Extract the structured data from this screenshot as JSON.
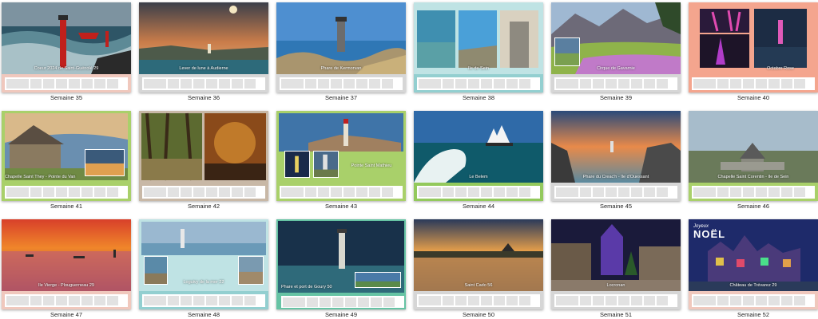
{
  "weeks": [
    {
      "label": "Semaine 35",
      "caption": "Coeur 2024 de Saint-Guénolé 29",
      "frame": "#f0c8bd"
    },
    {
      "label": "Semaine 36",
      "caption": "Lever de lune à Audierne",
      "frame": "#d6d6d6"
    },
    {
      "label": "Semaine 37",
      "caption": "Phare de Kermorvan",
      "frame": "#d6d6d6"
    },
    {
      "label": "Semaine 38",
      "caption": "Ile de Sein",
      "frame": "#93cfd0"
    },
    {
      "label": "Semaine 39",
      "caption": "Cirque de Gavarnie",
      "frame": "#d6d6d6"
    },
    {
      "label": "Semaine 40",
      "caption": "Octobre Rose",
      "frame": "#f4a58e"
    },
    {
      "label": "Semaine 41",
      "caption": "Chapelle Saint They - Pointe du Van",
      "frame": "#a9d06a"
    },
    {
      "label": "Semaine 42",
      "caption": "",
      "frame": "#c8b8a6"
    },
    {
      "label": "Semaine 43",
      "caption": "Pointe Saint Mathieu",
      "frame": "#a9d06a"
    },
    {
      "label": "Semaine 44",
      "caption": "Le Belem",
      "frame": "#93c95c"
    },
    {
      "label": "Semaine 45",
      "caption": "Phare du Creac'h - île d'Ouessant",
      "frame": "#d6d6d6"
    },
    {
      "label": "Semaine 46",
      "caption": "Chapelle Saint Corentin - Ile de Sein",
      "frame": "#a9d06a"
    },
    {
      "label": "Semaine 47",
      "caption": "Ile Vierge - Plouguerneau 29",
      "frame": "#f0c8bd"
    },
    {
      "label": "Semaine 48",
      "caption": "Loguivy de la mer 22",
      "frame": "#93cfd0"
    },
    {
      "label": "Semaine 49",
      "caption": "Phare et port de Goury 50",
      "frame": "#66c3a4"
    },
    {
      "label": "Semaine 50",
      "caption": "Saint Cado 56",
      "frame": "#d6d6d6"
    },
    {
      "label": "Semaine 51",
      "caption": "Locronan",
      "frame": "#d6d6d6"
    },
    {
      "label": "Semaine 52",
      "caption": "Château de Trévarez 29",
      "frame": "#f0c8bd"
    }
  ],
  "badge": {
    "small": "Joyeux",
    "big": "NOËL"
  },
  "colors": {
    "text": "#222222",
    "placeholder": "#e2e2e2"
  }
}
